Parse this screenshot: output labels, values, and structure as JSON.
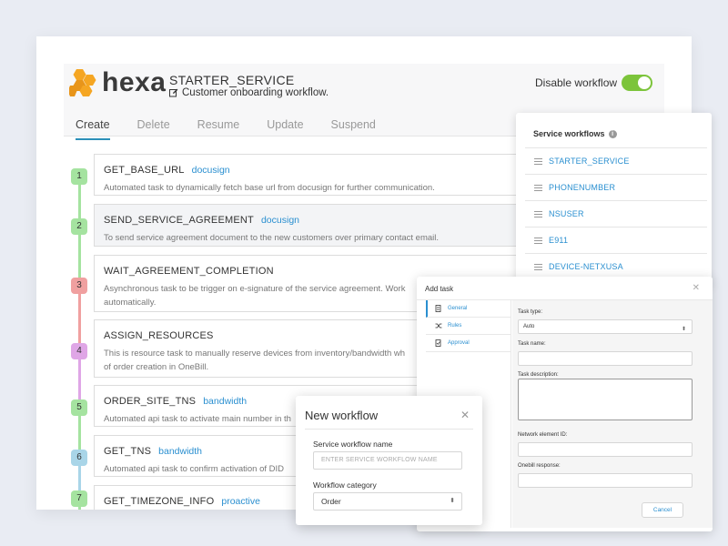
{
  "header": {
    "logo_text": "hexa",
    "service_name": "STARTER_SERVICE",
    "service_description": "Customer onboarding workflow.",
    "toggle_label": "Disable workflow",
    "toggle_on": true
  },
  "tabs": [
    {
      "label": "Create",
      "active": true
    },
    {
      "label": "Delete",
      "active": false
    },
    {
      "label": "Resume",
      "active": false
    },
    {
      "label": "Update",
      "active": false
    },
    {
      "label": "Suspend",
      "active": false
    }
  ],
  "tasks": [
    {
      "step": "1",
      "name": "GET_BASE_URL",
      "tag": "docusign",
      "description": "Automated task to dynamically fetch base url from docusign for further communication."
    },
    {
      "step": "2",
      "name": "SEND_SERVICE_AGREEMENT",
      "tag": "docusign",
      "description": "To send service agreement document to the new customers over primary contact email."
    },
    {
      "step": "3",
      "name": "WAIT_AGREEMENT_COMPLETION",
      "tag": "",
      "description": "Asynchronous task to be trigger on e-signature of the service agreement. Work",
      "description_line2": "automatically."
    },
    {
      "step": "4",
      "name": "ASSIGN_RESOURCES",
      "tag": "",
      "description": "This is resource task to manually reserve devices from inventory/bandwidth wh",
      "description_line2": "of order creation in OneBill."
    },
    {
      "step": "5",
      "name": "ORDER_SITE_TNS",
      "tag": "bandwidth",
      "description": "Automated api task to activate main number in th"
    },
    {
      "step": "6",
      "name": "GET_TNS",
      "tag": "bandwidth",
      "description": "Automated api task to confirm activation of DID"
    },
    {
      "step": "7",
      "name": "GET_TIMEZONE_INFO",
      "tag": "proactive",
      "description": ""
    }
  ],
  "service_workflows": {
    "title": "Service workflows",
    "items": [
      "STARTER_SERVICE",
      "PHONENUMBER",
      "NSUSER",
      "E911",
      "DEVICE-NETXUSA"
    ]
  },
  "add_task": {
    "title": "Add task",
    "nav": [
      "General",
      "Rules",
      "Approval"
    ],
    "task_type_label": "Task type:",
    "task_type_value": "Auto",
    "task_name_label": "Task name:",
    "task_description_label": "Task description:",
    "network_element_label": "Network element ID:",
    "onebill_response_label": "Onebill response:",
    "cancel_label": "Cancel"
  },
  "new_workflow": {
    "title": "New workflow",
    "name_label": "Service workflow name",
    "name_placeholder": "ENTER SERVICE WORKFLOW NAME",
    "category_label": "Workflow category",
    "category_value": "Order"
  },
  "colors": {
    "accent": "#2a8fd0",
    "toggle": "#7cc43b",
    "step_green": "#a5e3a0",
    "step_red": "#f0a0a0",
    "step_purple": "#dfa6e6",
    "step_blue": "#a9d5e8"
  }
}
